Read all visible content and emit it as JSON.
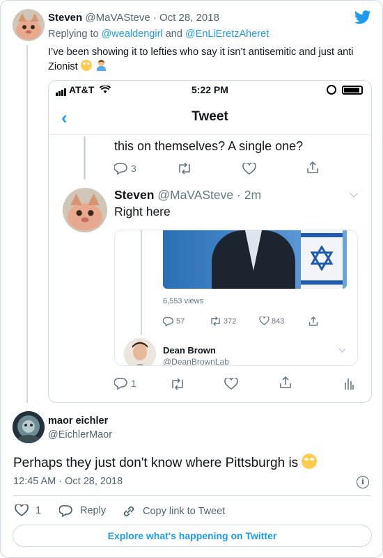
{
  "outer_tweet": {
    "name": "Steven",
    "handle": "@MaVASteve",
    "date": "· Oct 28, 2018",
    "replying_prefix": "Replying to",
    "replying_user1": "@wealdengirl",
    "replying_and": "and",
    "replying_user2": "@EnLiEretzAheret",
    "text": "I’ve been showing it to lefties who say it isn’t antisemitic and just anti Zionist"
  },
  "screenshot": {
    "status": {
      "carrier": "AT&T",
      "time": "5:22 PM"
    },
    "nav": {
      "title": "Tweet"
    },
    "prev_tweet_text": "this on themselves? A single one?",
    "prev_actions": {
      "replies": "3"
    },
    "reply": {
      "name": "Steven",
      "handle": "@MaVASteve",
      "age": "· 2m",
      "text": "Right here"
    },
    "quote": {
      "views": "6,553 views",
      "replies": "57",
      "retweets": "372",
      "likes": "843",
      "author_name": "Dean Brown",
      "author_handle": "@DeanBrownLab"
    },
    "reply_actions": {
      "replies": "1"
    }
  },
  "main_tweet": {
    "name": "maor eichler",
    "handle": "@EichlerMaor",
    "text": "Perhaps they just don't know where Pittsburgh is",
    "timestamp": "12:45 AM · Oct 28, 2018",
    "likes": "1",
    "reply_label": "Reply",
    "copy_label": "Copy link to Tweet"
  },
  "explore_label": "Explore what's happening on Twitter",
  "colors": {
    "twitter_blue": "#1d9bf0",
    "muted": "#536471",
    "border": "#cfd9de"
  }
}
